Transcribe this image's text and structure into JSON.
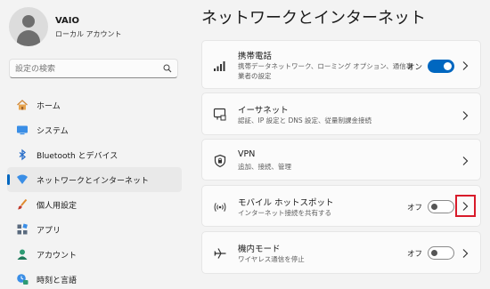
{
  "user": {
    "name": "VAIO",
    "account_type": "ローカル アカウント"
  },
  "search": {
    "placeholder": "設定の検索"
  },
  "nav": {
    "items": [
      {
        "label": "ホーム",
        "icon": "home-icon"
      },
      {
        "label": "システム",
        "icon": "system-icon"
      },
      {
        "label": "Bluetooth とデバイス",
        "icon": "bluetooth-icon"
      },
      {
        "label": "ネットワークとインターネット",
        "icon": "network-icon",
        "active": true
      },
      {
        "label": "個人用設定",
        "icon": "personalization-icon"
      },
      {
        "label": "アプリ",
        "icon": "apps-icon"
      },
      {
        "label": "アカウント",
        "icon": "account-icon"
      },
      {
        "label": "時刻と言語",
        "icon": "time-language-icon"
      }
    ]
  },
  "main": {
    "title": "ネットワークとインターネット",
    "cards": [
      {
        "title": "携帯電話",
        "subtitle_line1": "携帯データネットワーク、ローミング オプション、通信事",
        "subtitle_line2": "業者の設定",
        "status": "オン",
        "toggle": "on",
        "icon": "cellular-icon"
      },
      {
        "title": "イーサネット",
        "subtitle_line1": "認証、IP 設定と DNS 設定、従量制課金接続",
        "icon": "ethernet-icon"
      },
      {
        "title": "VPN",
        "subtitle_line1": "追加、接続、管理",
        "icon": "vpn-shield-icon"
      },
      {
        "title": "モバイル ホットスポット",
        "subtitle_line1": "インターネット接続を共有する",
        "status": "オフ",
        "toggle": "off",
        "icon": "hotspot-icon",
        "highlighted": true
      },
      {
        "title": "機内モード",
        "subtitle_line1": "ワイヤレス通信を停止",
        "status": "オフ",
        "toggle": "off",
        "icon": "airplane-icon"
      }
    ]
  },
  "colors": {
    "accent": "#0067c0",
    "highlight": "#d81b2a",
    "background": "#f3f3f3",
    "card": "#fbfbfb"
  }
}
